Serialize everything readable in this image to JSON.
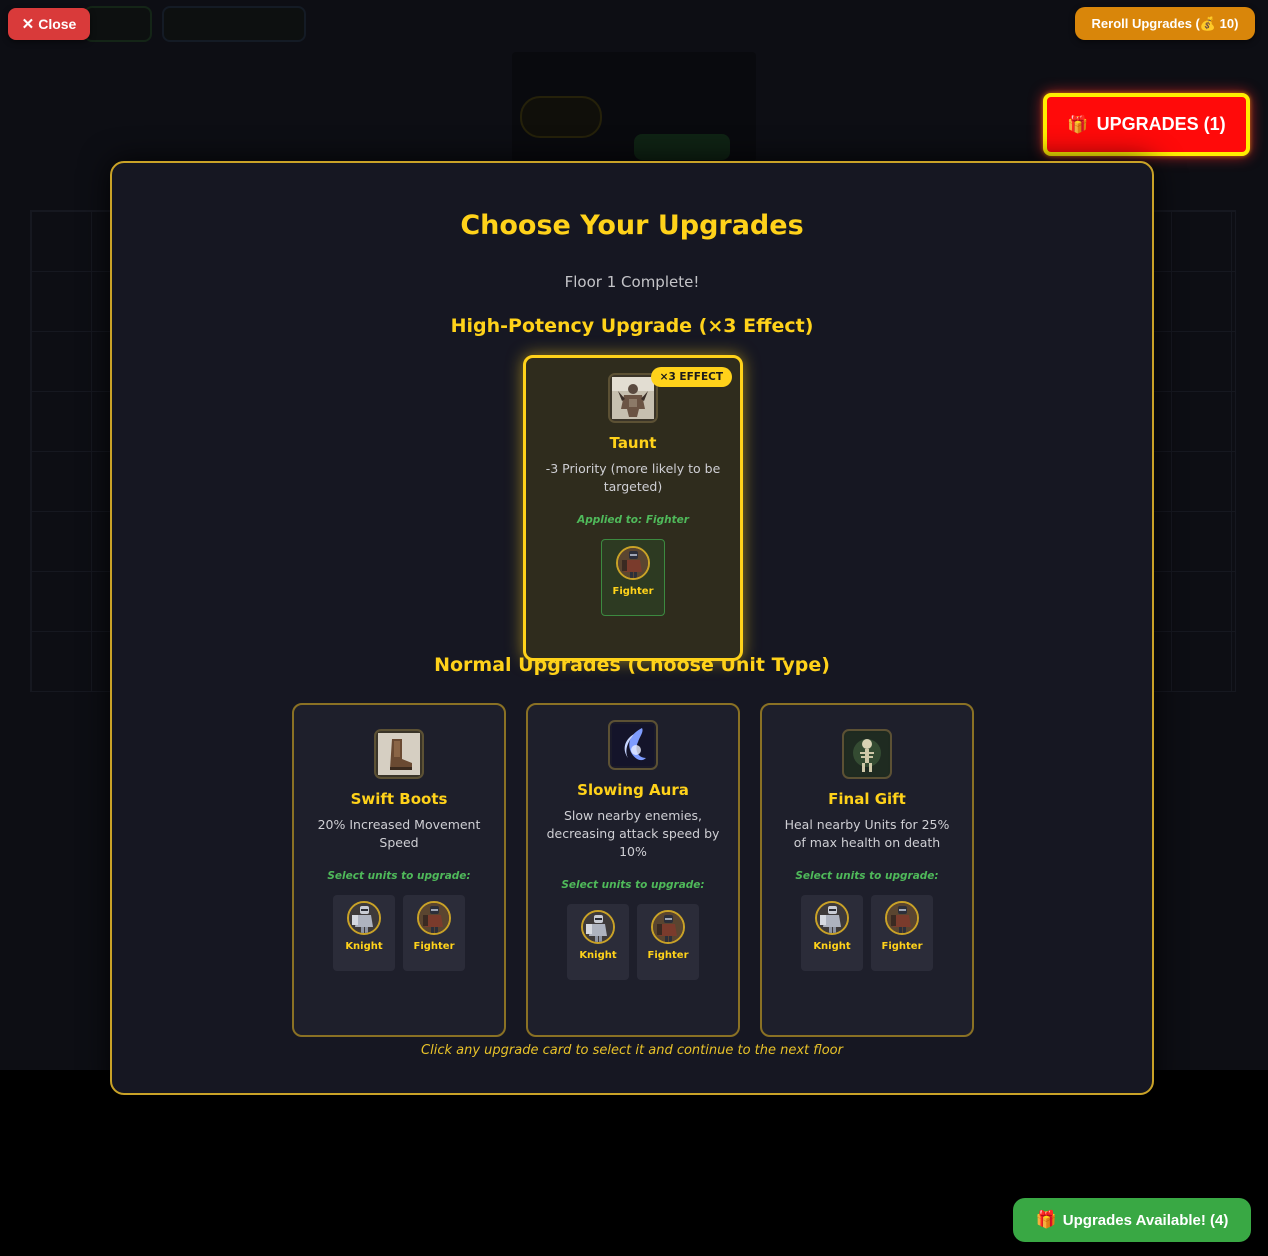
{
  "top": {
    "close_label": "Close",
    "close_icon": "✕",
    "reroll_label": "Reroll Upgrades (💰 10)",
    "upgrades_badge_icon": "🎁",
    "upgrades_badge_label": "UPGRADES (1)"
  },
  "modal": {
    "title": "Choose Your Upgrades",
    "subtitle": "Floor 1 Complete!",
    "high_section_title": "High-Potency Upgrade (×3 Effect)",
    "normal_section_title": "Normal Upgrades (Choose Unit Type)",
    "footer_hint": "Click any upgrade card to select it and continue to the next floor"
  },
  "high_card": {
    "badge": "×3 EFFECT",
    "name": "Taunt",
    "description": "-3 Priority (more likely to be targeted)",
    "applied_to": "Applied to: Fighter",
    "icon": "taunt-icon",
    "units": [
      {
        "name": "Fighter",
        "icon": "fighter-portrait"
      }
    ]
  },
  "normal_cards": [
    {
      "name": "Swift Boots",
      "description": "20% Increased Movement Speed",
      "select_prompt": "Select units to upgrade:",
      "icon": "boots-icon",
      "units": [
        {
          "name": "Knight"
        },
        {
          "name": "Fighter"
        }
      ]
    },
    {
      "name": "Slowing Aura",
      "description": "Slow nearby enemies, decreasing attack speed by 10%",
      "select_prompt": "Select units to upgrade:",
      "icon": "aura-icon",
      "units": [
        {
          "name": "Knight"
        },
        {
          "name": "Fighter"
        }
      ]
    },
    {
      "name": "Final Gift",
      "description": "Heal nearby Units for 25% of max health on death",
      "select_prompt": "Select units to upgrade:",
      "icon": "skeleton-icon",
      "units": [
        {
          "name": "Knight"
        },
        {
          "name": "Fighter"
        }
      ]
    }
  ],
  "bottom": {
    "available_icon": "🎁",
    "available_label": "Upgrades Available! (4)"
  },
  "colors": {
    "accent_gold": "#ffd21a",
    "close_red": "#d93a3a",
    "reroll_orange": "#d9860a",
    "badge_red": "#ff0a0a",
    "available_green": "#39a844"
  }
}
